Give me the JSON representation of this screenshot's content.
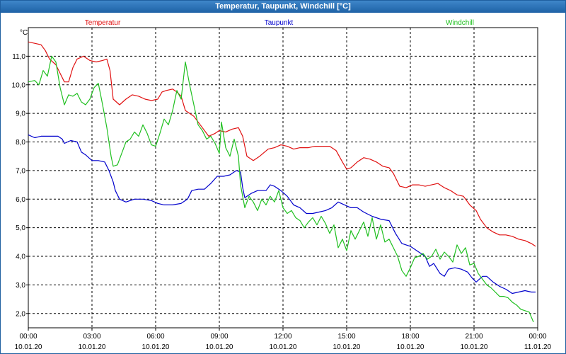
{
  "window": {
    "title": "Temperatur, Taupunkt, Windchill [°C]"
  },
  "chart_data": {
    "type": "line",
    "title": "Temperatur, Taupunkt, Windchill [°C]",
    "ylabel": "°C",
    "xlabel": "",
    "xlim": [
      0,
      24
    ],
    "ylim": [
      1.5,
      12.0
    ],
    "grid": true,
    "legend_placement": "top",
    "yticks": [
      {
        "value": 2.0,
        "label": "2,0"
      },
      {
        "value": 3.0,
        "label": "3,0"
      },
      {
        "value": 4.0,
        "label": "4,0"
      },
      {
        "value": 5.0,
        "label": "5,0"
      },
      {
        "value": 6.0,
        "label": "6,0"
      },
      {
        "value": 7.0,
        "label": "7,0"
      },
      {
        "value": 8.0,
        "label": "8,0"
      },
      {
        "value": 9.0,
        "label": "9,0"
      },
      {
        "value": 10.0,
        "label": "10,0"
      },
      {
        "value": 11.0,
        "label": "11,0"
      }
    ],
    "xticks": [
      {
        "value": 0,
        "time": "00:00",
        "date": "10.01.20"
      },
      {
        "value": 3,
        "time": "03:00",
        "date": "10.01.20"
      },
      {
        "value": 6,
        "time": "06:00",
        "date": "10.01.20"
      },
      {
        "value": 9,
        "time": "09:00",
        "date": "10.01.20"
      },
      {
        "value": 12,
        "time": "12:00",
        "date": "10.01.20"
      },
      {
        "value": 15,
        "time": "15:00",
        "date": "10.01.20"
      },
      {
        "value": 18,
        "time": "18:00",
        "date": "10.01.20"
      },
      {
        "value": 21,
        "time": "21:00",
        "date": "10.01.20"
      },
      {
        "value": 24,
        "time": "00:00",
        "date": "11.01.20"
      }
    ],
    "series": [
      {
        "name": "Temperatur",
        "color": "#e01010",
        "points": [
          [
            0,
            11.5
          ],
          [
            0.3,
            11.45
          ],
          [
            0.6,
            11.4
          ],
          [
            0.8,
            11.2
          ],
          [
            1.0,
            10.9
          ],
          [
            1.3,
            10.7
          ],
          [
            1.5,
            10.4
          ],
          [
            1.7,
            10.1
          ],
          [
            1.9,
            10.1
          ],
          [
            2.1,
            10.6
          ],
          [
            2.3,
            10.9
          ],
          [
            2.6,
            11.0
          ],
          [
            2.9,
            10.85
          ],
          [
            3.2,
            10.8
          ],
          [
            3.5,
            10.85
          ],
          [
            3.7,
            10.9
          ],
          [
            3.85,
            10.5
          ],
          [
            4.0,
            9.5
          ],
          [
            4.3,
            9.3
          ],
          [
            4.6,
            9.5
          ],
          [
            4.9,
            9.65
          ],
          [
            5.2,
            9.6
          ],
          [
            5.5,
            9.5
          ],
          [
            5.8,
            9.45
          ],
          [
            6.1,
            9.5
          ],
          [
            6.3,
            9.75
          ],
          [
            6.5,
            9.8
          ],
          [
            6.8,
            9.85
          ],
          [
            7.0,
            9.75
          ],
          [
            7.2,
            9.6
          ],
          [
            7.4,
            9.1
          ],
          [
            7.6,
            9.0
          ],
          [
            7.8,
            8.9
          ],
          [
            8.0,
            8.7
          ],
          [
            8.2,
            8.5
          ],
          [
            8.5,
            8.2
          ],
          [
            8.8,
            8.3
          ],
          [
            9.0,
            8.4
          ],
          [
            9.3,
            8.35
          ],
          [
            9.6,
            8.45
          ],
          [
            9.9,
            8.5
          ],
          [
            10.1,
            8.2
          ],
          [
            10.3,
            7.5
          ],
          [
            10.6,
            7.35
          ],
          [
            10.9,
            7.5
          ],
          [
            11.3,
            7.75
          ],
          [
            11.6,
            7.8
          ],
          [
            11.9,
            7.9
          ],
          [
            12.2,
            7.85
          ],
          [
            12.5,
            7.75
          ],
          [
            12.8,
            7.8
          ],
          [
            13.2,
            7.8
          ],
          [
            13.5,
            7.85
          ],
          [
            13.8,
            7.85
          ],
          [
            14.2,
            7.85
          ],
          [
            14.5,
            7.7
          ],
          [
            14.8,
            7.3
          ],
          [
            15.0,
            7.05
          ],
          [
            15.2,
            7.1
          ],
          [
            15.5,
            7.3
          ],
          [
            15.8,
            7.45
          ],
          [
            16.1,
            7.4
          ],
          [
            16.4,
            7.3
          ],
          [
            16.7,
            7.15
          ],
          [
            17.0,
            7.1
          ],
          [
            17.2,
            6.9
          ],
          [
            17.5,
            6.45
          ],
          [
            17.8,
            6.4
          ],
          [
            18.1,
            6.5
          ],
          [
            18.4,
            6.5
          ],
          [
            18.7,
            6.45
          ],
          [
            19.0,
            6.5
          ],
          [
            19.3,
            6.55
          ],
          [
            19.6,
            6.4
          ],
          [
            19.9,
            6.3
          ],
          [
            20.2,
            6.15
          ],
          [
            20.5,
            6.1
          ],
          [
            20.8,
            5.8
          ],
          [
            21.1,
            5.6
          ],
          [
            21.3,
            5.3
          ],
          [
            21.6,
            5.0
          ],
          [
            21.9,
            4.85
          ],
          [
            22.2,
            4.75
          ],
          [
            22.5,
            4.75
          ],
          [
            22.8,
            4.7
          ],
          [
            23.1,
            4.6
          ],
          [
            23.4,
            4.55
          ],
          [
            23.7,
            4.45
          ],
          [
            23.9,
            4.35
          ]
        ]
      },
      {
        "name": "Taupunkt",
        "color": "#0000cc",
        "points": [
          [
            0,
            8.25
          ],
          [
            0.3,
            8.15
          ],
          [
            0.6,
            8.2
          ],
          [
            1.0,
            8.2
          ],
          [
            1.4,
            8.2
          ],
          [
            1.6,
            8.1
          ],
          [
            1.7,
            7.95
          ],
          [
            2.0,
            8.05
          ],
          [
            2.3,
            8.0
          ],
          [
            2.5,
            7.65
          ],
          [
            2.7,
            7.55
          ],
          [
            3.0,
            7.35
          ],
          [
            3.3,
            7.35
          ],
          [
            3.6,
            7.3
          ],
          [
            3.8,
            7.0
          ],
          [
            4.0,
            6.6
          ],
          [
            4.1,
            6.3
          ],
          [
            4.3,
            6.0
          ],
          [
            4.6,
            5.9
          ],
          [
            5.0,
            6.0
          ],
          [
            5.4,
            6.0
          ],
          [
            5.8,
            5.95
          ],
          [
            6.1,
            5.85
          ],
          [
            6.4,
            5.8
          ],
          [
            6.8,
            5.8
          ],
          [
            7.2,
            5.85
          ],
          [
            7.5,
            6.0
          ],
          [
            7.7,
            6.3
          ],
          [
            8.0,
            6.35
          ],
          [
            8.3,
            6.35
          ],
          [
            8.6,
            6.55
          ],
          [
            8.9,
            6.8
          ],
          [
            9.2,
            6.8
          ],
          [
            9.5,
            6.85
          ],
          [
            9.8,
            7.0
          ],
          [
            10.0,
            6.95
          ],
          [
            10.1,
            6.4
          ],
          [
            10.2,
            6.05
          ],
          [
            10.5,
            6.2
          ],
          [
            10.8,
            6.3
          ],
          [
            11.2,
            6.3
          ],
          [
            11.4,
            6.5
          ],
          [
            11.6,
            6.45
          ],
          [
            11.9,
            6.3
          ],
          [
            12.2,
            6.1
          ],
          [
            12.5,
            5.8
          ],
          [
            12.8,
            5.7
          ],
          [
            13.1,
            5.5
          ],
          [
            13.4,
            5.5
          ],
          [
            13.7,
            5.55
          ],
          [
            14.0,
            5.6
          ],
          [
            14.3,
            5.7
          ],
          [
            14.6,
            5.9
          ],
          [
            14.9,
            5.8
          ],
          [
            15.2,
            5.7
          ],
          [
            15.5,
            5.7
          ],
          [
            15.8,
            5.55
          ],
          [
            16.2,
            5.4
          ],
          [
            16.6,
            5.3
          ],
          [
            17.0,
            5.25
          ],
          [
            17.3,
            4.8
          ],
          [
            17.6,
            4.45
          ],
          [
            18.0,
            4.35
          ],
          [
            18.3,
            4.2
          ],
          [
            18.7,
            4.0
          ],
          [
            18.9,
            3.65
          ],
          [
            19.1,
            3.75
          ],
          [
            19.4,
            3.4
          ],
          [
            19.6,
            3.3
          ],
          [
            19.8,
            3.55
          ],
          [
            20.1,
            3.6
          ],
          [
            20.4,
            3.55
          ],
          [
            20.7,
            3.45
          ],
          [
            20.9,
            3.25
          ],
          [
            21.1,
            3.1
          ],
          [
            21.4,
            3.3
          ],
          [
            21.6,
            3.3
          ],
          [
            21.9,
            3.1
          ],
          [
            22.2,
            2.95
          ],
          [
            22.5,
            2.85
          ],
          [
            22.8,
            2.7
          ],
          [
            23.1,
            2.75
          ],
          [
            23.4,
            2.8
          ],
          [
            23.7,
            2.75
          ],
          [
            23.9,
            2.75
          ]
        ]
      },
      {
        "name": "Windchill",
        "color": "#20c020",
        "points": [
          [
            0,
            10.1
          ],
          [
            0.3,
            10.15
          ],
          [
            0.5,
            10.0
          ],
          [
            0.7,
            10.5
          ],
          [
            0.9,
            10.3
          ],
          [
            1.1,
            11.0
          ],
          [
            1.3,
            10.8
          ],
          [
            1.5,
            9.9
          ],
          [
            1.7,
            9.3
          ],
          [
            1.9,
            9.65
          ],
          [
            2.1,
            9.6
          ],
          [
            2.3,
            9.7
          ],
          [
            2.5,
            9.4
          ],
          [
            2.7,
            9.3
          ],
          [
            2.9,
            9.5
          ],
          [
            3.1,
            9.9
          ],
          [
            3.3,
            10.05
          ],
          [
            3.5,
            9.3
          ],
          [
            3.7,
            8.5
          ],
          [
            3.9,
            7.5
          ],
          [
            4.0,
            7.15
          ],
          [
            4.2,
            7.2
          ],
          [
            4.4,
            7.6
          ],
          [
            4.6,
            8.0
          ],
          [
            4.8,
            8.1
          ],
          [
            5.0,
            8.35
          ],
          [
            5.2,
            8.2
          ],
          [
            5.4,
            8.6
          ],
          [
            5.6,
            8.3
          ],
          [
            5.8,
            7.9
          ],
          [
            6.0,
            7.85
          ],
          [
            6.2,
            8.3
          ],
          [
            6.4,
            8.8
          ],
          [
            6.6,
            8.6
          ],
          [
            6.8,
            9.1
          ],
          [
            7.0,
            9.8
          ],
          [
            7.2,
            9.5
          ],
          [
            7.4,
            10.8
          ],
          [
            7.6,
            10.0
          ],
          [
            7.8,
            9.3
          ],
          [
            8.0,
            8.6
          ],
          [
            8.2,
            8.4
          ],
          [
            8.4,
            8.1
          ],
          [
            8.6,
            8.2
          ],
          [
            8.8,
            7.95
          ],
          [
            9.0,
            7.6
          ],
          [
            9.1,
            8.7
          ],
          [
            9.3,
            7.8
          ],
          [
            9.5,
            7.5
          ],
          [
            9.7,
            8.1
          ],
          [
            9.9,
            7.5
          ],
          [
            10.0,
            6.5
          ],
          [
            10.2,
            5.7
          ],
          [
            10.4,
            6.1
          ],
          [
            10.6,
            5.9
          ],
          [
            10.8,
            5.6
          ],
          [
            11.0,
            6.0
          ],
          [
            11.2,
            5.8
          ],
          [
            11.4,
            6.1
          ],
          [
            11.6,
            5.9
          ],
          [
            11.8,
            6.3
          ],
          [
            12.0,
            5.7
          ],
          [
            12.2,
            5.5
          ],
          [
            12.4,
            5.6
          ],
          [
            12.6,
            5.35
          ],
          [
            12.8,
            5.25
          ],
          [
            13.0,
            5.0
          ],
          [
            13.2,
            5.2
          ],
          [
            13.4,
            5.35
          ],
          [
            13.6,
            5.1
          ],
          [
            13.8,
            5.4
          ],
          [
            14.0,
            5.15
          ],
          [
            14.2,
            4.8
          ],
          [
            14.4,
            5.1
          ],
          [
            14.6,
            4.3
          ],
          [
            14.8,
            4.6
          ],
          [
            15.0,
            4.2
          ],
          [
            15.2,
            4.9
          ],
          [
            15.4,
            4.6
          ],
          [
            15.6,
            4.9
          ],
          [
            15.8,
            5.2
          ],
          [
            16.0,
            4.7
          ],
          [
            16.2,
            5.35
          ],
          [
            16.4,
            4.6
          ],
          [
            16.6,
            5.1
          ],
          [
            16.8,
            4.5
          ],
          [
            17.0,
            4.6
          ],
          [
            17.2,
            4.3
          ],
          [
            17.4,
            4.0
          ],
          [
            17.6,
            3.5
          ],
          [
            17.8,
            3.3
          ],
          [
            18.0,
            3.6
          ],
          [
            18.2,
            3.95
          ],
          [
            18.4,
            4.0
          ],
          [
            18.6,
            4.1
          ],
          [
            18.8,
            3.9
          ],
          [
            19.0,
            4.0
          ],
          [
            19.2,
            4.25
          ],
          [
            19.4,
            3.9
          ],
          [
            19.6,
            4.15
          ],
          [
            19.8,
            4.0
          ],
          [
            20.0,
            3.8
          ],
          [
            20.2,
            4.4
          ],
          [
            20.4,
            4.1
          ],
          [
            20.6,
            4.3
          ],
          [
            20.8,
            3.7
          ],
          [
            21.0,
            3.75
          ],
          [
            21.2,
            3.4
          ],
          [
            21.4,
            3.2
          ],
          [
            21.6,
            3.0
          ],
          [
            21.8,
            2.9
          ],
          [
            22.0,
            2.75
          ],
          [
            22.2,
            2.6
          ],
          [
            22.4,
            2.6
          ],
          [
            22.6,
            2.55
          ],
          [
            22.8,
            2.4
          ],
          [
            23.0,
            2.3
          ],
          [
            23.2,
            2.15
          ],
          [
            23.4,
            2.1
          ],
          [
            23.6,
            2.05
          ],
          [
            23.8,
            1.7
          ]
        ]
      }
    ]
  }
}
